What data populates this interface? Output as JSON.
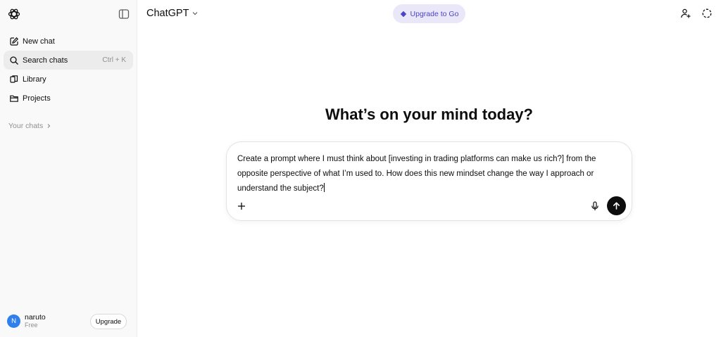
{
  "sidebar": {
    "logo_icon": "chatgpt-logo-icon",
    "toggle_icon": "sidebar-toggle-icon",
    "items": [
      {
        "label": "New chat",
        "icon": "compose-icon"
      },
      {
        "label": "Search chats",
        "icon": "search-icon",
        "shortcut": "Ctrl + K"
      },
      {
        "label": "Library",
        "icon": "library-icon"
      },
      {
        "label": "Projects",
        "icon": "folder-icon"
      }
    ],
    "section_label": "Your chats",
    "profile": {
      "initial": "N",
      "name": "naruto",
      "plan": "Free",
      "upgrade_label": "Upgrade"
    }
  },
  "header": {
    "model_label": "ChatGPT",
    "promo_label": "Upgrade to Go",
    "accent_color": "#4b45c6"
  },
  "main": {
    "headline": "What’s on your mind today?",
    "composer": {
      "text": "Create a prompt where I must think about [investing in trading platforms can make us rich?] from the opposite perspective of what I’m used to. How does this new mindset change the way I approach or understand the subject?"
    }
  }
}
